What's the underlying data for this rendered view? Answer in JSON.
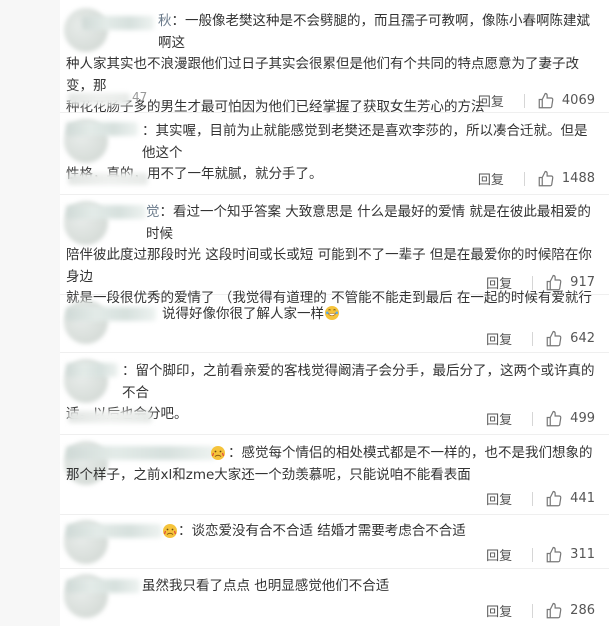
{
  "colors": {
    "text": "#333333",
    "reply": "#555555",
    "accent_name": "#6a7a8a",
    "divider": "#efefef"
  },
  "icons": {
    "like": "thumbs-up-icon",
    "emoji_grin": "grinning-face-icon",
    "emoji_tears": "crying-face-icon"
  },
  "comments": [
    {
      "name_tail": "秋",
      "line1": "：一般像老樊这种是不会劈腿的，而且孺子可教啊，像陈小春啊陈建斌啊这",
      "line2": "种人家其实也不浪漫跟他们过日子其实会很累但是他们有个共同的特点愿意为了妻子改变，那",
      "line3": "种花花肠子多的男生才最可怕因为他们已经掌握了获取女生芳心的方法",
      "time_tail": "47",
      "reply": "回复",
      "likes": "4069"
    },
    {
      "line1": "：其实喔，目前为止就能感觉到老樊还是喜欢李莎的，所以凑合迁就。但是他这个",
      "line2": "性格，真的，用不了一年就腻，就分手了。",
      "reply": "回复",
      "likes": "1488"
    },
    {
      "name_tail": "觉",
      "line1": "：看过一个知乎答案 大致意思是 什么是最好的爱情 就是在彼此最相爱的时候",
      "line2": "陪伴彼此度过那段时光 这段时间或长或短 可能到不了一辈子 但是在最爱你的时候陪在你身边",
      "line3": "就是一段很优秀的爱情了 （我觉得有道理的 不管能不能走到最后 在一起的时候有爱就行",
      "reply": "回复",
      "likes": "917"
    },
    {
      "line1": "说得好像你很了解人家一样",
      "reply": "回复",
      "likes": "642"
    },
    {
      "line1": "：留个脚印，之前看亲爱的客栈觉得阚清子会分手，最后分了，这两个或许真的不合",
      "line2": "适。以后也会分吧。",
      "reply": "回复",
      "likes": "499"
    },
    {
      "line1": "：感觉每个情侣的相处模式都是不一样的，也不是我们想象的",
      "line2": "那个样子，之前xl和zme大家还一个劲羡慕呢，只能说咱不能看表面",
      "reply": "回复",
      "likes": "441"
    },
    {
      "line1": "：谈恋爱没有合不合适  结婚才需要考虑合不合适",
      "reply": "回复",
      "likes": "311"
    },
    {
      "line1": "虽然我只看了点点 也明显感觉他们不合适",
      "reply": "回复",
      "likes": "286"
    }
  ]
}
